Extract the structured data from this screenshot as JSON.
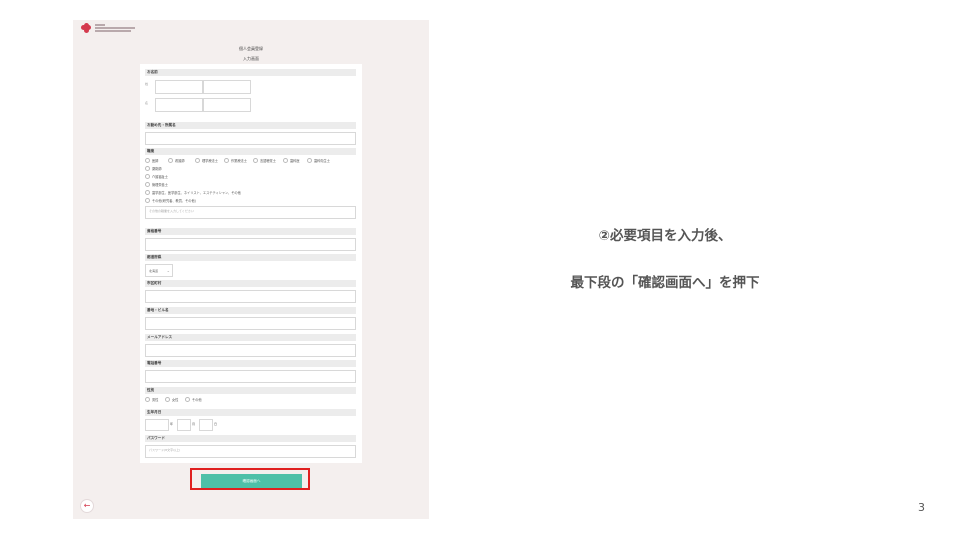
{
  "form": {
    "title": "個人会員登録",
    "subtitle": "入力画面",
    "sections": {
      "name": "お名前",
      "kana": "お名前(カナ)",
      "workplace": "お勤め先・所属名",
      "occupation": "職業",
      "license": "資格番号",
      "prefecture": "都道府県",
      "city": "市区町村",
      "building": "番地・ビル名",
      "email": "メールアドレス",
      "phone": "電話番号",
      "gender": "性別",
      "birthdate": "生年月日",
      "password": "パスワード"
    },
    "name_labels": {
      "sei": "姓",
      "mei": "名"
    },
    "occupation_options": [
      "医師",
      "看護師",
      "理学療法士",
      "作業療法士",
      "言語聴覚士",
      "歯科医",
      "歯科衛生士",
      "薬剤師",
      "介護福祉士",
      "管理栄養士",
      "歯学部生、医学部生、ネイリスト、エステティシャン、その他",
      "その他(研究者、教員、その他)"
    ],
    "occupation_other_placeholder": "その他の職業を入力してください",
    "prefecture_value": "北海道",
    "gender_options": [
      "男性",
      "女性",
      "その他"
    ],
    "birth_units": {
      "year": "年",
      "month": "月",
      "day": "日"
    },
    "password_placeholder": "パスワード(8文字以上)",
    "confirm_button": "確認画面へ"
  },
  "instructions": {
    "line1": "②必要項目を入力後、",
    "line2": "最下段の「確認画面へ」を押下"
  },
  "page_number": "3",
  "colors": {
    "accent": "#d43a4e",
    "button": "#4ec0a8",
    "highlight": "#e02020",
    "panel": "#f4efee"
  },
  "icons": {
    "back": "back-arrow-icon"
  }
}
